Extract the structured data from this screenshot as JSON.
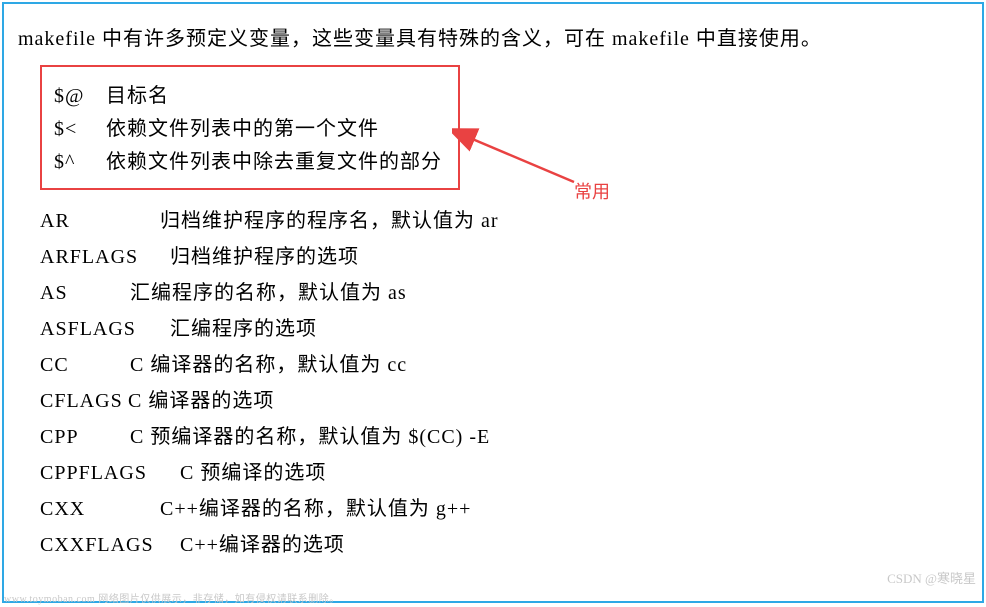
{
  "intro": "makefile 中有许多预定义变量，这些变量具有特殊的含义，可在 makefile 中直接使用。",
  "boxed": [
    {
      "sym": "$@",
      "desc": "目标名"
    },
    {
      "sym": "$<",
      "desc": "依赖文件列表中的第一个文件"
    },
    {
      "sym": "$^",
      "desc": "依赖文件列表中除去重复文件的部分"
    }
  ],
  "arrowLabel": "常用",
  "defs": [
    {
      "name": "AR",
      "desc": "归档维护程序的程序名，默认值为 ar"
    },
    {
      "name": "ARFLAGS",
      "desc": "归档维护程序的选项"
    },
    {
      "name": "AS",
      "desc": "汇编程序的名称，默认值为 as"
    },
    {
      "name": "ASFLAGS",
      "desc": "汇编程序的选项"
    },
    {
      "name": "CC",
      "desc": "C 编译器的名称，默认值为 cc"
    },
    {
      "name": "CFLAGS",
      "desc": "C 编译器的选项"
    },
    {
      "name": "CPP",
      "desc": "C 预编译器的名称，默认值为 $(CC) -E"
    },
    {
      "name": "CPPFLAGS",
      "desc": "C 预编译的选项"
    },
    {
      "name": "CXX",
      "desc": "C++编译器的名称，默认值为 g++"
    },
    {
      "name": "CXXFLAGS",
      "desc": "C++编译器的选项"
    }
  ],
  "watermarkLeft": "www.toymoban.com  网络图片仅供展示，非存储，如有侵权请联系删除。",
  "watermarkRight": "CSDN @寒晓星"
}
